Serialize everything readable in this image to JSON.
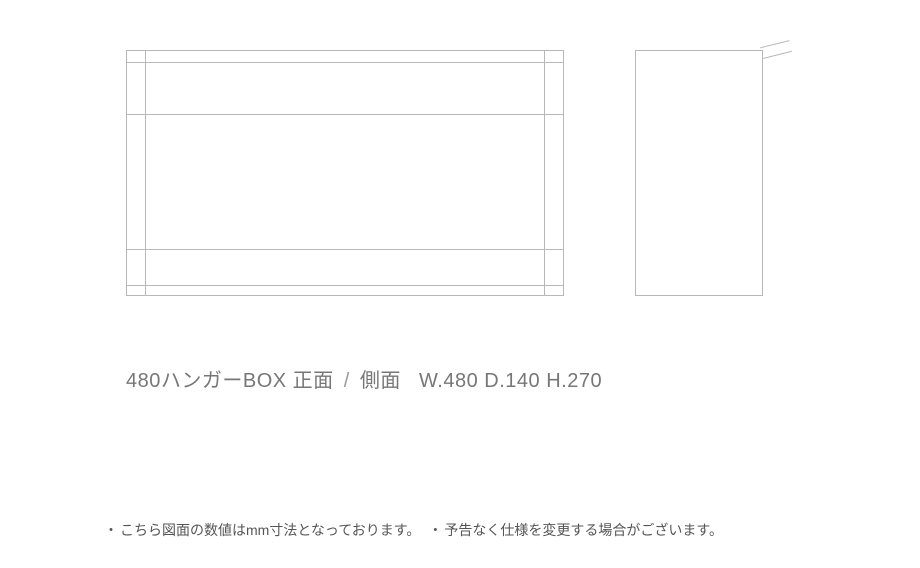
{
  "product": {
    "name": "480ハンガーBOX",
    "view_front": "正面",
    "view_side": "側面",
    "dims": "W.480 D.140 H.270"
  },
  "notes": {
    "bullet": "・",
    "line1": "こちら図面の数値はmm寸法となっております。",
    "line2": "予告なく仕様を変更する場合がございます。"
  }
}
